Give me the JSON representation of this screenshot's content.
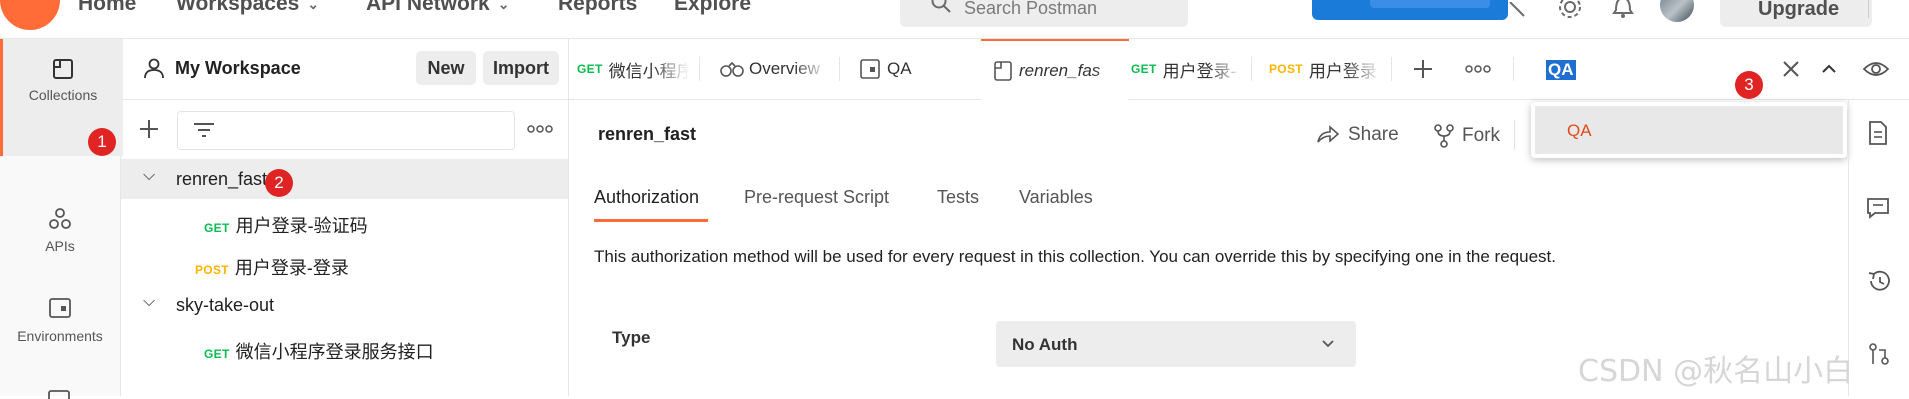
{
  "nav": {
    "home": "Home",
    "workspaces": "Workspaces",
    "api_network": "API Network",
    "reports": "Reports",
    "explore": "Explore",
    "search_placeholder": "Search Postman",
    "upgrade": "Upgrade"
  },
  "workspace": {
    "title": "My Workspace",
    "new_label": "New",
    "import_label": "Import"
  },
  "rail": {
    "items": [
      {
        "label": "Collections",
        "icon": "collections-icon",
        "active": true
      },
      {
        "label": "APIs",
        "icon": "apis-icon",
        "active": false
      },
      {
        "label": "Environments",
        "icon": "environments-icon",
        "active": false
      }
    ]
  },
  "tree": [
    {
      "type": "collection",
      "name": "renren_fast",
      "expanded": true,
      "selected": true
    },
    {
      "type": "request",
      "method": "GET",
      "name": "用户登录-验证码"
    },
    {
      "type": "request",
      "method": "POST",
      "name": "用户登录-登录"
    },
    {
      "type": "collection",
      "name": "sky-take-out",
      "expanded": true
    },
    {
      "type": "request",
      "method": "GET",
      "name": "微信小程序登录服务接口"
    }
  ],
  "tabs": [
    {
      "method": "GET",
      "label": "微信小程序"
    },
    {
      "label": "Overview"
    },
    {
      "label": "QA"
    },
    {
      "label": "renren_fas",
      "active": true
    },
    {
      "method": "GET",
      "label": "用户登录-"
    },
    {
      "method": "POST",
      "label": "用户登录"
    }
  ],
  "find": {
    "query": "QA",
    "result": "QA"
  },
  "collection_view": {
    "title": "renren_fast",
    "share_label": "Share",
    "fork_label": "Fork",
    "subtabs": [
      "Authorization",
      "Pre-request Script",
      "Tests",
      "Variables"
    ],
    "active_subtab": "Authorization",
    "description": "This authorization method will be used for every request in this collection. You can override this by specifying one in the request.",
    "type_label": "Type",
    "auth_type": "No Auth"
  },
  "badges": [
    "1",
    "2",
    "3"
  ],
  "watermark": "CSDN @秋名山小白",
  "colors": {
    "accent": "#ff6c37",
    "get": "#0cbb52",
    "post": "#ffb400",
    "badge": "#e02424",
    "find_highlight": "#1f6fd1"
  }
}
